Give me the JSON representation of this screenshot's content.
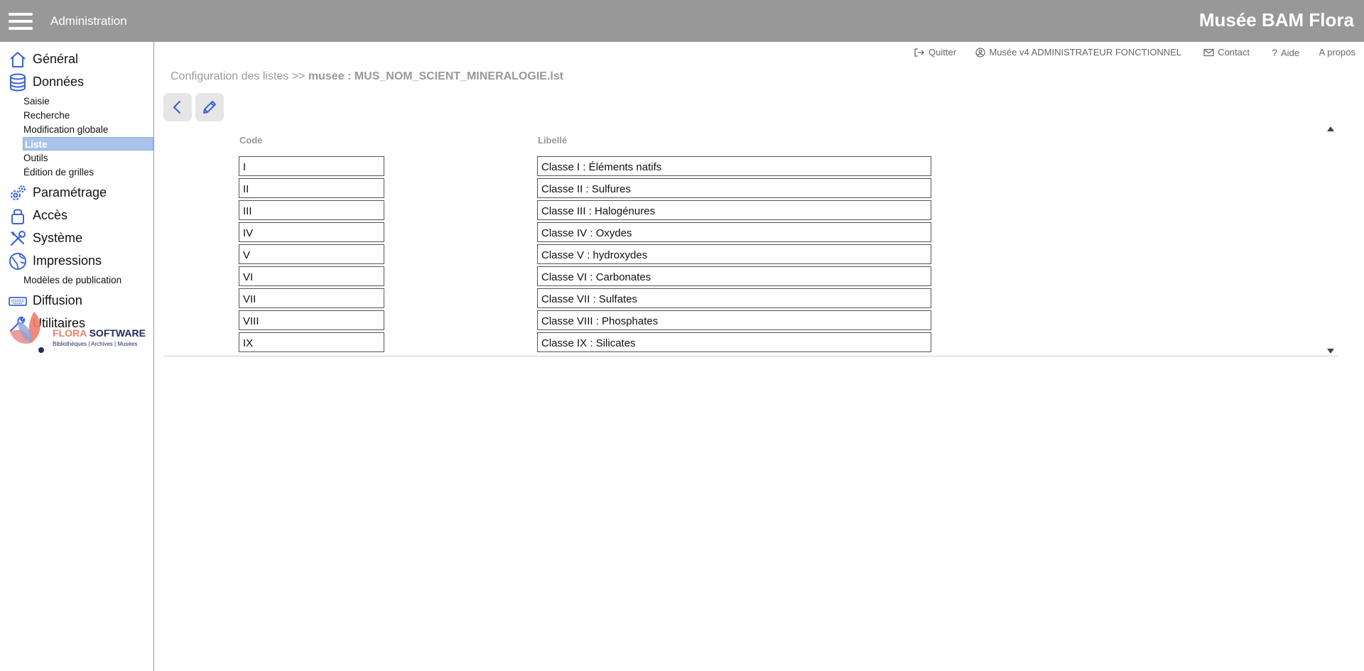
{
  "header": {
    "app_title": "Administration",
    "brand": "Musée BAM Flora"
  },
  "top_links": {
    "quit": "Quitter",
    "user": "Musée v4 ADMINISTRATEUR FONCTIONNEL",
    "contact": "Contact",
    "help": "Aide",
    "about": "A propos"
  },
  "sidebar": {
    "general": "Général",
    "data": "Données",
    "data_items": [
      "Saisie",
      "Recherche",
      "Modification globale",
      "Liste",
      "Outils",
      "Édition de grilles"
    ],
    "settings": "Paramétrage",
    "access": "Accès",
    "system": "Système",
    "prints": "Impressions",
    "print_items": [
      "Modèles de publication"
    ],
    "diffusion": "Diffusion",
    "utilities": "Utilitaires",
    "active_item": "Liste"
  },
  "logo": {
    "brand_a": "FLORA",
    "brand_b": "SOFTWARE",
    "tagline": "Bibliothèques | Archives | Musées"
  },
  "breadcrumb": {
    "prefix": "Configuration des listes >>",
    "current": "musee : MUS_NOM_SCIENT_MINERALOGIE.lst"
  },
  "toolbar": {
    "back_icon": "chevron-left-icon",
    "edit_icon": "pencil-icon"
  },
  "table": {
    "headers": {
      "code": "Code",
      "label": "Libellé"
    },
    "rows": [
      {
        "code": "I",
        "label": "Classe I : Éléments natifs"
      },
      {
        "code": "II",
        "label": "Classe II : Sulfures"
      },
      {
        "code": "III",
        "label": "Classe III : Halogénures"
      },
      {
        "code": "IV",
        "label": "Classe IV : Oxydes"
      },
      {
        "code": "V",
        "label": "Classe V : hydroxydes"
      },
      {
        "code": "VI",
        "label": "Classe VI : Carbonates"
      },
      {
        "code": "VII",
        "label": "Classe VII : Sulfates"
      },
      {
        "code": "VIII",
        "label": "Classe VIII : Phosphates"
      },
      {
        "code": "IX",
        "label": "Classe IX : Silicates"
      }
    ]
  },
  "colors": {
    "topbar": "#989898",
    "accent": "#3a63d8",
    "active_bg": "#a9c3ec",
    "logo_coral": "#ef7d6b",
    "logo_navy": "#232a5c"
  }
}
